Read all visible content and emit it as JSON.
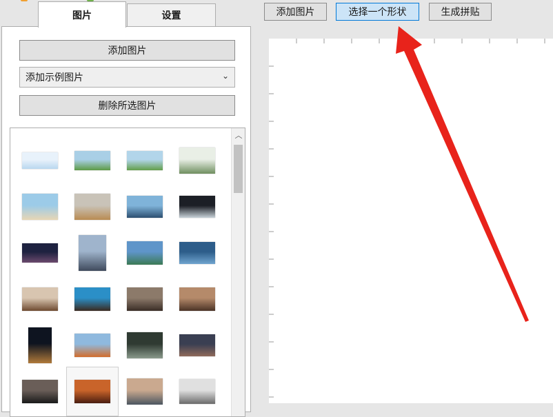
{
  "tabs": [
    {
      "label": "图片",
      "active": true
    },
    {
      "label": "设置",
      "active": false
    }
  ],
  "left_panel": {
    "add_button_label": "添加图片",
    "sample_select_value": "添加示例图片",
    "delete_button_label": "删除所选图片"
  },
  "toolbar": {
    "add_label": "添加图片",
    "shape_label": "选择一个形状",
    "generate_label": "生成拼贴"
  },
  "thumbnails": [
    {
      "name": "thumb-screenshot-blue",
      "colors": [
        "#e8f2fb",
        "#b9d7ef"
      ],
      "w": 52,
      "h": 24
    },
    {
      "name": "thumb-green-field-1",
      "colors": [
        "#a9cfe6",
        "#5d9a45"
      ],
      "w": 52,
      "h": 28
    },
    {
      "name": "thumb-green-field-2",
      "colors": [
        "#b2d5ea",
        "#629e4a"
      ],
      "w": 52,
      "h": 28
    },
    {
      "name": "thumb-framed-document",
      "colors": [
        "#e9efe6",
        "#6f8f5f"
      ],
      "w": 52,
      "h": 38
    },
    {
      "name": "thumb-beach",
      "colors": [
        "#9ccbe8",
        "#e8d6b4"
      ],
      "w": 52,
      "h": 38
    },
    {
      "name": "thumb-desert-haze",
      "colors": [
        "#c9c3b8",
        "#b98b52"
      ],
      "w": 52,
      "h": 38
    },
    {
      "name": "thumb-harbor",
      "colors": [
        "#7fb3d9",
        "#2d4f70"
      ],
      "w": 52,
      "h": 32
    },
    {
      "name": "thumb-tunnel-night",
      "colors": [
        "#1c1f26",
        "#c8d2d8"
      ],
      "w": 52,
      "h": 32
    },
    {
      "name": "thumb-milky-way",
      "colors": [
        "#1e2240",
        "#6b4a6e"
      ],
      "w": 52,
      "h": 28
    },
    {
      "name": "thumb-city-skyline",
      "colors": [
        "#9fb4cc",
        "#3f4a5c"
      ],
      "w": 40,
      "h": 52
    },
    {
      "name": "thumb-mountain-lake",
      "colors": [
        "#5f95c9",
        "#3b7a55"
      ],
      "w": 52,
      "h": 34
    },
    {
      "name": "thumb-lake-reflection",
      "colors": [
        "#2d5d8a",
        "#6fa4cf"
      ],
      "w": 52,
      "h": 32
    },
    {
      "name": "thumb-dining-room",
      "colors": [
        "#d8c5b0",
        "#6e4a30"
      ],
      "w": 52,
      "h": 34
    },
    {
      "name": "thumb-sea-arch",
      "colors": [
        "#2b8fc7",
        "#3a2a20"
      ],
      "w": 52,
      "h": 34
    },
    {
      "name": "thumb-cafe-interior",
      "colors": [
        "#8c7a6a",
        "#3a2d26"
      ],
      "w": 52,
      "h": 34
    },
    {
      "name": "thumb-restaurant",
      "colors": [
        "#b58a6a",
        "#4b3326"
      ],
      "w": 52,
      "h": 34
    },
    {
      "name": "thumb-canyon-dark",
      "colors": [
        "#0e1420",
        "#b07a3a"
      ],
      "w": 34,
      "h": 52
    },
    {
      "name": "thumb-red-dunes",
      "colors": [
        "#8fb9de",
        "#d26d2c"
      ],
      "w": 52,
      "h": 34
    },
    {
      "name": "thumb-car-interior",
      "colors": [
        "#2f3a32",
        "#8a9a8c"
      ],
      "w": 52,
      "h": 38
    },
    {
      "name": "thumb-sunset-silhouette",
      "colors": [
        "#3a3f52",
        "#8f6a5a"
      ],
      "w": 52,
      "h": 32
    },
    {
      "name": "thumb-camera-bag",
      "colors": [
        "#6a5e58",
        "#1a1a1a"
      ],
      "w": 52,
      "h": 34
    },
    {
      "name": "thumb-antelope-canyon",
      "colors": [
        "#c9642a",
        "#4a1d10"
      ],
      "w": 52,
      "h": 34
    },
    {
      "name": "thumb-desk-items",
      "colors": [
        "#caa98f",
        "#4c5660"
      ],
      "w": 52,
      "h": 38
    },
    {
      "name": "thumb-foggy-mountains",
      "colors": [
        "#e0e0e0",
        "#6a6a6a"
      ],
      "w": 52,
      "h": 36
    }
  ],
  "annotation": {
    "arrow_color": "#e8231b"
  },
  "colors": {
    "selected_button_bg": "#cce4f7",
    "selected_button_border": "#0078d7",
    "window_bg": "#e6e6e6"
  }
}
